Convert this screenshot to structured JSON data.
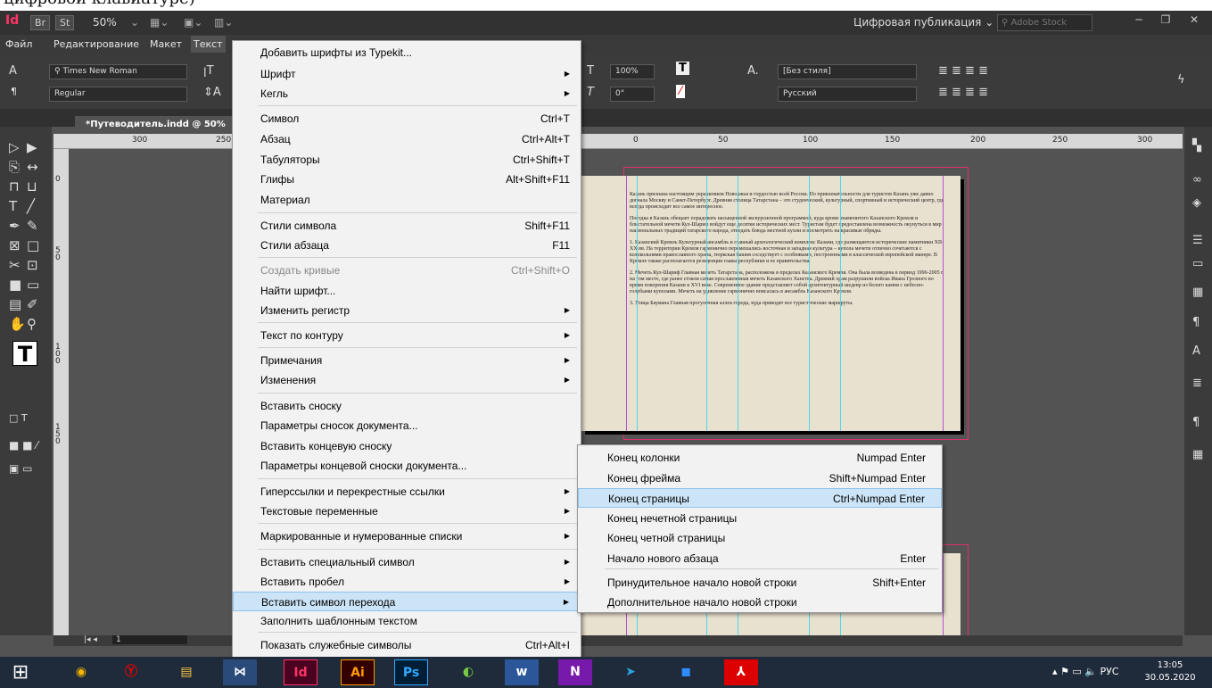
{
  "caption": "цифровой клавиатуре)",
  "appbar": {
    "logo": "Id",
    "bridge": "Br",
    "stock_btn": "St",
    "zoom": "50%",
    "workspace": "Цифровая публикация",
    "search_placeholder": "Adobe Stock"
  },
  "menubar": {
    "items": [
      "Файл",
      "Редактирование",
      "Макет",
      "Текст"
    ]
  },
  "control": {
    "font_family": "Times New Roman",
    "font_style": "Regular",
    "scale": "100%",
    "skew": "0°",
    "paragraph_style": "[Без стиля]",
    "language": "Русский"
  },
  "document": {
    "tab_title": "*Путеводитель.indd @ 50%",
    "ruler_marks": [
      "300",
      "250",
      "0",
      "50",
      "100",
      "150",
      "200",
      "250",
      "300"
    ],
    "vruler_marks": [
      "0",
      "50",
      "100",
      "150"
    ],
    "page_number": "1",
    "paragraphs": [
      "Казань признана настоящим украшением Поволжья и гордостью всей России. По привлекательности для туристов Казань уже давно догнала Москву и Санкт-Петербург. Древняя столица Татарстана – это студенческий, культурный, спортивный и исторический центр, где всегда происходит все самое интересное.",
      "Поездка в Казань обещает порадовать насыщенной экскурсионной программой, куда кроме знаменитого Казанского Кремля и блистательной мечети Кул-Шариф войдут еще десятки исторических мест. Туристам будет предоставлена возможность окунуться в мир национальных традиций татарского народа, отведать блюда местной кухни и посмотреть на красивые обряды.",
      "1. Казанский Кремль Культурный ансамбль и главный археологический комплекс Казани, где размещаются исторические памятники XII-XX вв. На территории Кремля гармонично перемешались восточная и западная культура – купола мечети отлично сочетаются с колокольнями православного храма, тюркская башня соседствует с особняками, построенными в классической европейской манере. В Кремле также располагается резиденция главы республики и ее правительства.",
      "2. Мечеть Кул-Шариф Главная мечеть Татарстана, расположена в пределах Казанского Кремля. Она была возведена в период 1996-2005 г. на том месте, где ранее стояли самая прославленная мечеть Казанского Ханства. Древний храм разрушили войска Ивана Грозного во время покорения Казани в XVI веке. Современное здание представляет собой архитектурный шедевр из белого камня с небесно-голубыми куполами. Мечеть на удивление гармонично вписалась в ансамбль Казанского Кремля.",
      "3. Улица Баумана Главная прогулочная аллея города, куда приводят все туристические маршруты."
    ]
  },
  "menu": {
    "items": [
      {
        "label": "Добавить шрифты из Typekit...",
        "shortcut": "",
        "arrow": false,
        "disabled": false
      },
      {
        "label": "Шрифт",
        "shortcut": "",
        "arrow": true,
        "disabled": false
      },
      {
        "label": "Кегль",
        "shortcut": "",
        "arrow": true,
        "disabled": false
      },
      {
        "label": "Символ",
        "shortcut": "Ctrl+T",
        "arrow": false,
        "disabled": false
      },
      {
        "label": "Абзац",
        "shortcut": "Ctrl+Alt+T",
        "arrow": false,
        "disabled": false
      },
      {
        "label": "Табуляторы",
        "shortcut": "Ctrl+Shift+T",
        "arrow": false,
        "disabled": false
      },
      {
        "label": "Глифы",
        "shortcut": "Alt+Shift+F11",
        "arrow": false,
        "disabled": false
      },
      {
        "label": "Материал",
        "shortcut": "",
        "arrow": false,
        "disabled": false
      },
      {
        "label": "Стили символа",
        "shortcut": "Shift+F11",
        "arrow": false,
        "disabled": false
      },
      {
        "label": "Стили абзаца",
        "shortcut": "F11",
        "arrow": false,
        "disabled": false
      },
      {
        "label": "Создать кривые",
        "shortcut": "Ctrl+Shift+O",
        "arrow": false,
        "disabled": true
      },
      {
        "label": "Найти шрифт...",
        "shortcut": "",
        "arrow": false,
        "disabled": false
      },
      {
        "label": "Изменить регистр",
        "shortcut": "",
        "arrow": true,
        "disabled": false
      },
      {
        "label": "Текст по контуру",
        "shortcut": "",
        "arrow": true,
        "disabled": false
      },
      {
        "label": "Примечания",
        "shortcut": "",
        "arrow": true,
        "disabled": false
      },
      {
        "label": "Изменения",
        "shortcut": "",
        "arrow": true,
        "disabled": false
      },
      {
        "label": "Вставить сноску",
        "shortcut": "",
        "arrow": false,
        "disabled": false
      },
      {
        "label": "Параметры сносок документа...",
        "shortcut": "",
        "arrow": false,
        "disabled": false
      },
      {
        "label": "Вставить концевую сноску",
        "shortcut": "",
        "arrow": false,
        "disabled": false
      },
      {
        "label": "Параметры концевой сноски документа...",
        "shortcut": "",
        "arrow": false,
        "disabled": false
      },
      {
        "label": "Гиперссылки и перекрестные ссылки",
        "shortcut": "",
        "arrow": true,
        "disabled": false
      },
      {
        "label": "Текстовые переменные",
        "shortcut": "",
        "arrow": true,
        "disabled": false
      },
      {
        "label": "Маркированные и нумерованные списки",
        "shortcut": "",
        "arrow": true,
        "disabled": false
      },
      {
        "label": "Вставить специальный символ",
        "shortcut": "",
        "arrow": true,
        "disabled": false
      },
      {
        "label": "Вставить пробел",
        "shortcut": "",
        "arrow": true,
        "disabled": false
      },
      {
        "label": "Вставить символ перехода",
        "shortcut": "",
        "arrow": true,
        "disabled": false,
        "selected": true
      },
      {
        "label": "Заполнить шаблонным текстом",
        "shortcut": "",
        "arrow": false,
        "disabled": false
      },
      {
        "label": "Показать служебные символы",
        "shortcut": "Ctrl+Alt+I",
        "arrow": false,
        "disabled": false
      }
    ]
  },
  "submenu": {
    "items": [
      {
        "label": "Конец колонки",
        "shortcut": "Numpad Enter"
      },
      {
        "label": "Конец фрейма",
        "shortcut": "Shift+Numpad Enter"
      },
      {
        "label": "Конец страницы",
        "shortcut": "Ctrl+Numpad Enter",
        "selected": true
      },
      {
        "label": "Конец нечетной страницы",
        "shortcut": ""
      },
      {
        "label": "Конец четной страницы",
        "shortcut": ""
      },
      {
        "label": "Начало нового абзаца",
        "shortcut": "Enter"
      },
      {
        "label": "Принудительное начало новой строки",
        "shortcut": "Shift+Enter"
      },
      {
        "label": "Дополнительное начало новой строки",
        "shortcut": ""
      }
    ]
  },
  "taskbar": {
    "apps": [
      "start-icon",
      "chrome-icon",
      "yandex-icon",
      "explorer-icon",
      "filmora-icon",
      "Id",
      "Ai",
      "Ps",
      "photos-icon",
      "w",
      "N",
      "telegram-icon",
      "zoom-icon",
      "acrobat-icon"
    ],
    "lang": "РУС",
    "time": "13:05",
    "date": "30.05.2020"
  }
}
